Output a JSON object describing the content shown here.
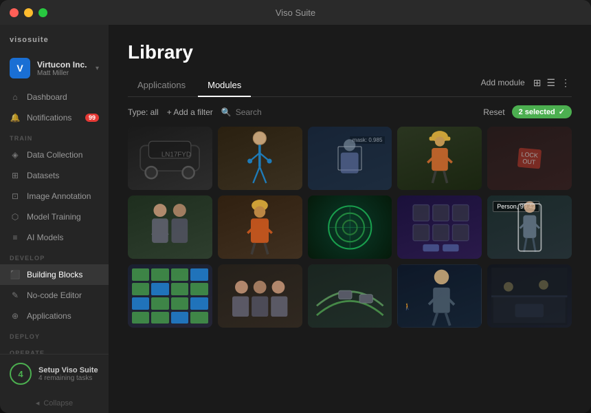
{
  "window": {
    "title": "Viso Suite"
  },
  "sidebar": {
    "logo": "visosuite",
    "org": {
      "name": "Virtucon Inc.",
      "user": "Matt Miller",
      "initial": "V"
    },
    "nav_items": [
      {
        "id": "dashboard",
        "label": "Dashboard",
        "icon": "home",
        "active": false
      },
      {
        "id": "notifications",
        "label": "Notifications",
        "icon": "bell",
        "badge": "99",
        "active": false
      }
    ],
    "sections": [
      {
        "label": "TRAIN",
        "items": [
          {
            "id": "data-collection",
            "label": "Data Collection",
            "icon": "database"
          },
          {
            "id": "datasets",
            "label": "Datasets",
            "icon": "grid"
          },
          {
            "id": "image-annotation",
            "label": "Image Annotation",
            "icon": "tag"
          },
          {
            "id": "model-training",
            "label": "Model Training",
            "icon": "cpu"
          },
          {
            "id": "ai-models",
            "label": "AI Models",
            "icon": "layers"
          }
        ]
      },
      {
        "label": "DEVELOP",
        "items": [
          {
            "id": "building-blocks",
            "label": "Building Blocks",
            "icon": "box",
            "active": true
          },
          {
            "id": "no-code-editor",
            "label": "No-code Editor",
            "icon": "edit"
          },
          {
            "id": "applications",
            "label": "Applications",
            "icon": "app"
          }
        ]
      },
      {
        "label": "DEPLOY",
        "items": []
      },
      {
        "label": "OPERATE",
        "items": []
      }
    ],
    "setup": {
      "number": "4",
      "title": "Setup Viso Suite",
      "subtitle": "4 remaining tasks"
    },
    "collapse_label": "Collapse"
  },
  "library": {
    "title": "Library",
    "tabs": [
      {
        "id": "applications",
        "label": "Applications",
        "active": false
      },
      {
        "id": "modules",
        "label": "Modules",
        "active": true
      }
    ],
    "add_module_label": "Add module",
    "filter_bar": {
      "type_label": "Type: all",
      "add_filter_label": "+ Add a filter",
      "search_placeholder": "Search",
      "reset_label": "Reset",
      "selected_label": "2 selected"
    },
    "grid_items": [
      {
        "id": 1,
        "color": "card-1",
        "icon": "🚗",
        "label": ""
      },
      {
        "id": 2,
        "color": "card-2",
        "icon": "🧍",
        "label": ""
      },
      {
        "id": 3,
        "color": "card-3",
        "icon": "👤",
        "label": "mask: 0.985"
      },
      {
        "id": 4,
        "color": "card-4",
        "icon": "👷",
        "label": ""
      },
      {
        "id": 5,
        "color": "card-5",
        "icon": "🔒",
        "label": ""
      },
      {
        "id": 6,
        "color": "card-6",
        "icon": "👫",
        "label": ""
      },
      {
        "id": 7,
        "color": "card-7",
        "icon": "🏗️",
        "label": ""
      },
      {
        "id": 8,
        "color": "card-8",
        "icon": "🌀",
        "label": ""
      },
      {
        "id": 9,
        "color": "card-9",
        "icon": "📦",
        "label": ""
      },
      {
        "id": 10,
        "color": "card-10",
        "icon": "🚶",
        "label": "Person, 99.42"
      },
      {
        "id": 11,
        "color": "card-11",
        "icon": "🚗",
        "label": ""
      },
      {
        "id": 12,
        "color": "card-12",
        "icon": "👥",
        "label": ""
      },
      {
        "id": 13,
        "color": "card-13",
        "icon": "🚙",
        "label": ""
      },
      {
        "id": 14,
        "color": "card-14",
        "icon": "🚶",
        "label": ""
      },
      {
        "id": 15,
        "color": "card-15",
        "icon": "🚆",
        "label": ""
      }
    ]
  }
}
